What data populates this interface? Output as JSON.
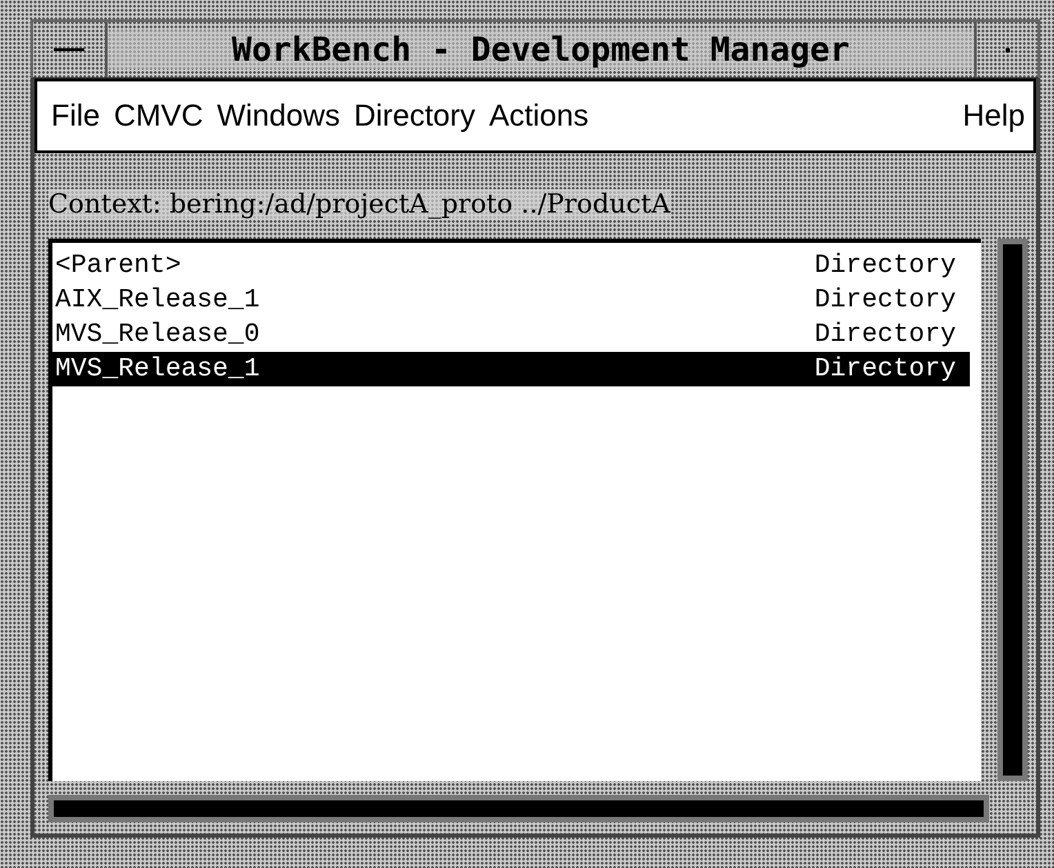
{
  "window": {
    "title": "WorkBench  -  Development Manager"
  },
  "menu": [
    {
      "label": "File"
    },
    {
      "label": "CMVC"
    },
    {
      "label": "Windows"
    },
    {
      "label": "Directory"
    },
    {
      "label": "Actions"
    },
    {
      "label": "Help",
      "kind": "right"
    }
  ],
  "context": "Context: bering:/ad/projectA_proto ../ProductA",
  "list": [
    {
      "name": "<Parent>",
      "type": "Directory",
      "selected": false
    },
    {
      "name": "AIX_Release_1",
      "type": "Directory",
      "selected": false
    },
    {
      "name": "MVS_Release_0",
      "type": "Directory",
      "selected": false
    },
    {
      "name": "MVS_Release_1",
      "type": "Directory",
      "selected": true
    }
  ]
}
